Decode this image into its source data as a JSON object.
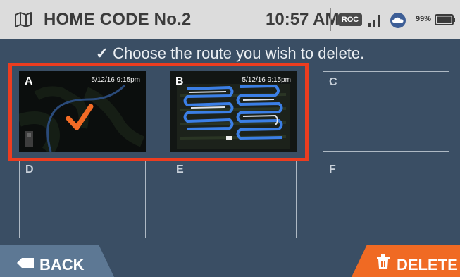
{
  "status_bar": {
    "icon": "map-icon",
    "title": "HOME CODE No.2",
    "time": "10:57 AM",
    "network_badge": "ROC",
    "signal_icon": "signal-bars-icon",
    "cloud_icon": "cloud-sync-icon",
    "battery_percent": "99%",
    "battery_icon": "battery-icon"
  },
  "instruction": {
    "check": "✓",
    "text": "Choose the route you wish to delete."
  },
  "routes": [
    {
      "letter": "A",
      "date": "5/12/16 9:15pm",
      "selected": true
    },
    {
      "letter": "B",
      "date": "5/12/16 9:15pm",
      "selected": false
    },
    {
      "letter": "C",
      "date": "",
      "selected": false
    },
    {
      "letter": "D",
      "date": "",
      "selected": false
    },
    {
      "letter": "E",
      "date": "",
      "selected": false
    },
    {
      "letter": "F",
      "date": "",
      "selected": false
    }
  ],
  "buttons": {
    "back": "BACK",
    "delete": "DELETE"
  },
  "colors": {
    "background": "#3a4e64",
    "status_bar": "#dcdcdc",
    "selection_border": "#ec3d20",
    "delete_button": "#f06a23",
    "back_button": "#5d7894",
    "route_line": "#3b7fe6"
  }
}
